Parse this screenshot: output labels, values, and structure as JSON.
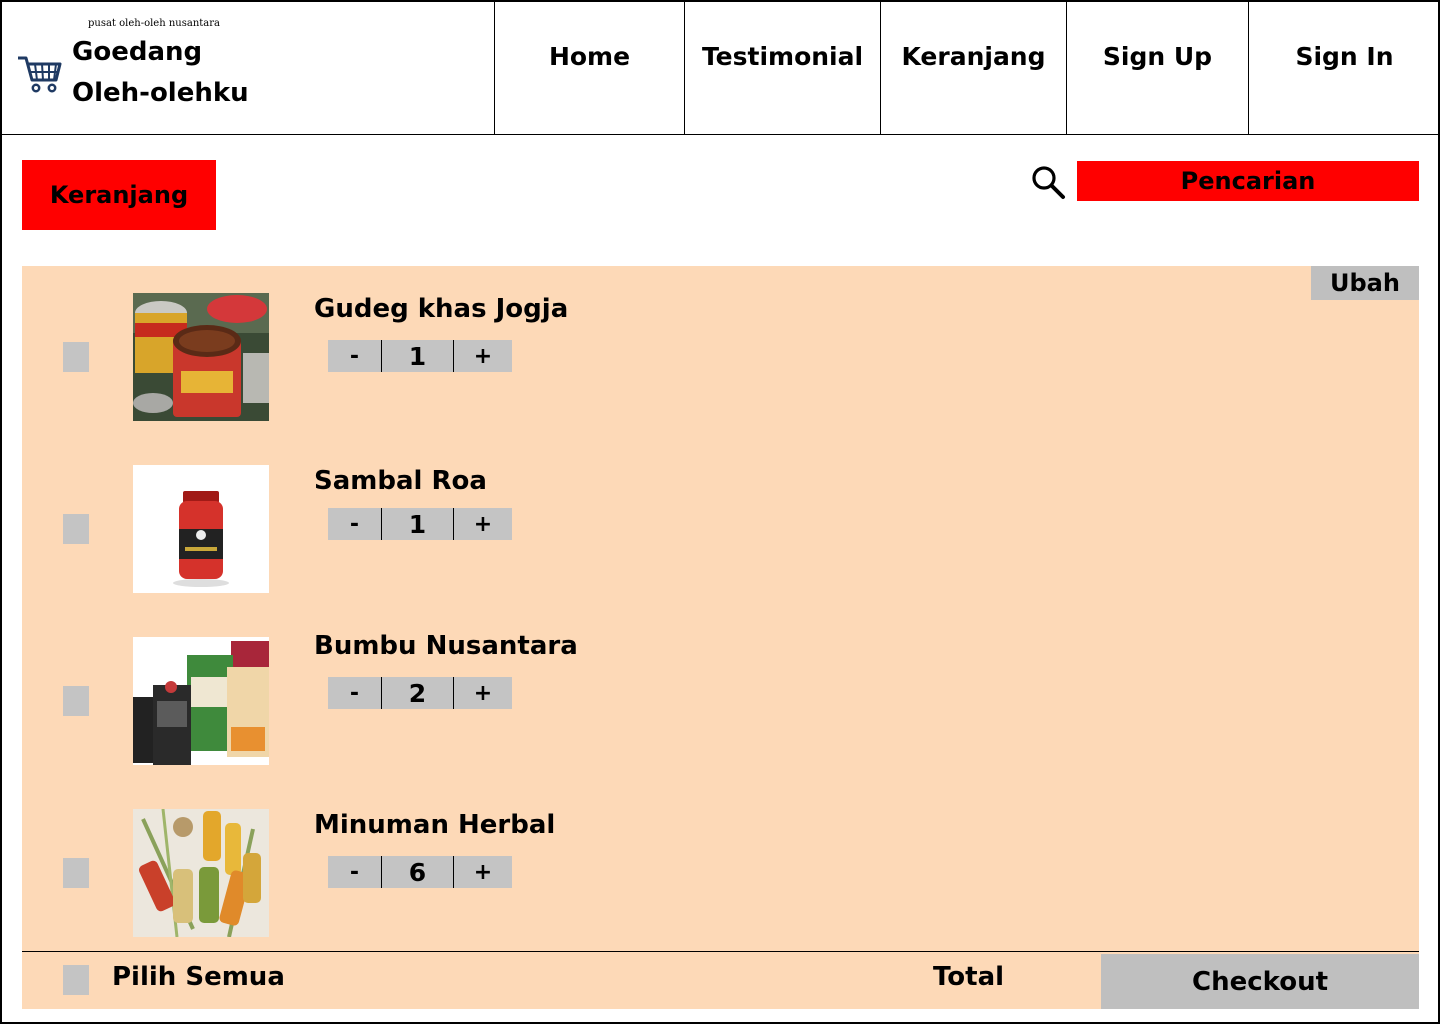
{
  "header": {
    "tagline": "pusat oleh-oleh nusantara",
    "brand_line1": "Goedang",
    "brand_line2": "Oleh-olehku",
    "logo_icon": "shopping-cart-icon",
    "nav": [
      {
        "label": "Home"
      },
      {
        "label": "Testimonial"
      },
      {
        "label": "Keranjang"
      },
      {
        "label": "Sign Up"
      },
      {
        "label": "Sign In"
      }
    ]
  },
  "page": {
    "title": "Keranjang",
    "search_icon": "search-icon",
    "search_placeholder": "Pencarian"
  },
  "cart": {
    "edit_label": "Ubah",
    "items": [
      {
        "name": "Gudeg khas Jogja",
        "qty": "1",
        "minus": "-",
        "plus": "+",
        "image": "gudeg-cans-photo"
      },
      {
        "name": "Sambal Roa",
        "qty": "1",
        "minus": "-",
        "plus": "+",
        "image": "sambal-jar-photo"
      },
      {
        "name": "Bumbu Nusantara",
        "qty": "2",
        "minus": "-",
        "plus": "+",
        "image": "spice-packets-photo"
      },
      {
        "name": "Minuman Herbal",
        "qty": "6",
        "minus": "-",
        "plus": "+",
        "image": "herbal-bottles-photo"
      }
    ]
  },
  "footer": {
    "select_all_label": "Pilih Semua",
    "total_label": "Total",
    "checkout_label": "Checkout"
  },
  "colors": {
    "accent": "#ff0000",
    "panel": "#fdd9b7",
    "control_gray": "#c4c4c4"
  }
}
